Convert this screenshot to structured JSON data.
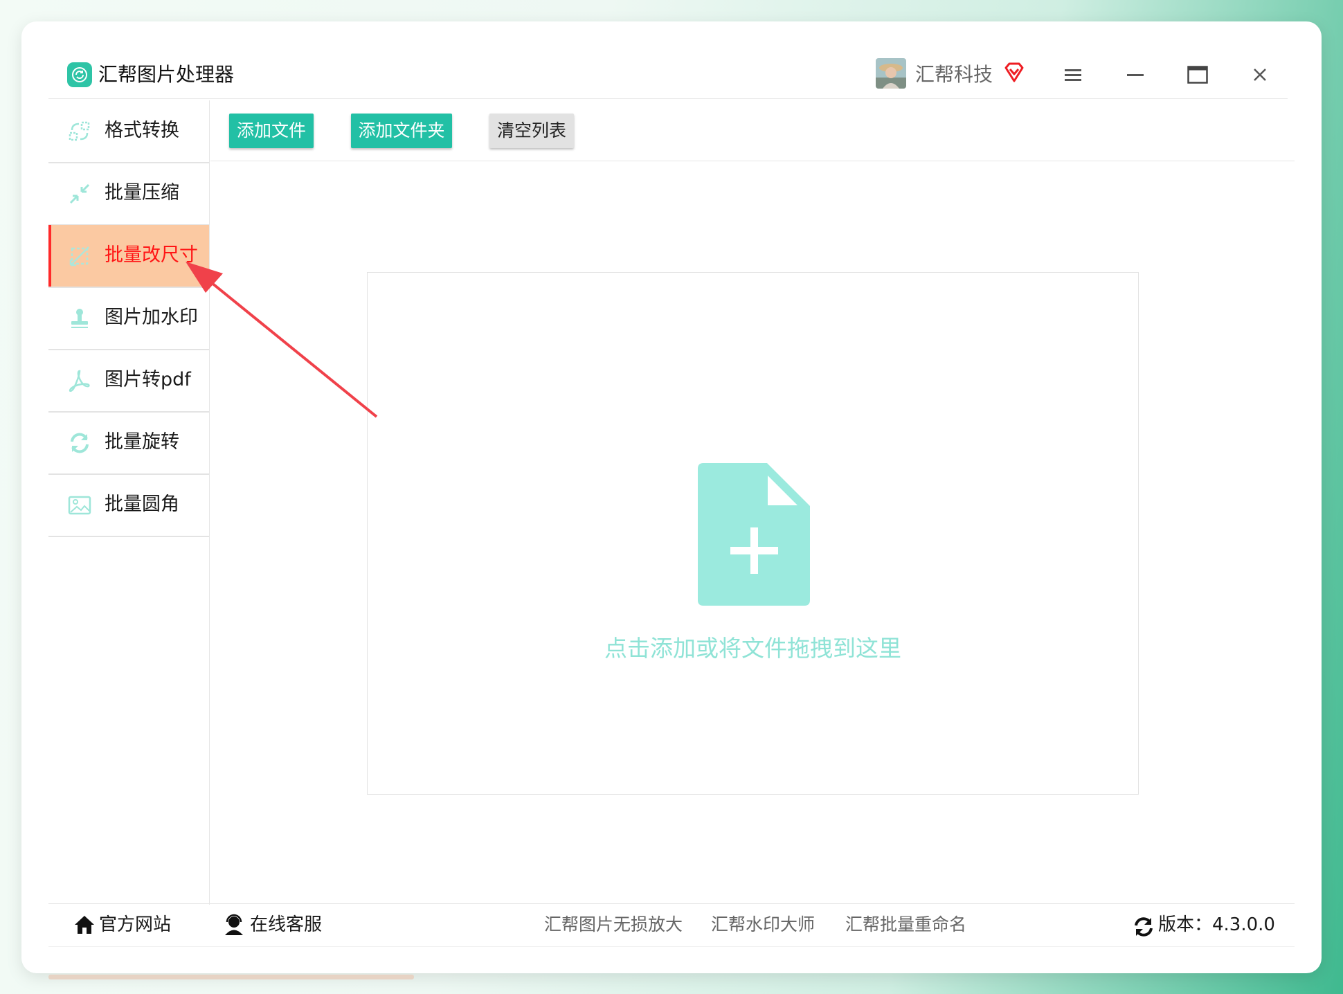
{
  "app": {
    "title": "汇帮图片处理器",
    "user_name": "汇帮科技"
  },
  "sidebar": {
    "items": [
      {
        "label": "格式转换",
        "icon": "format-convert-icon",
        "active": false
      },
      {
        "label": "批量压缩",
        "icon": "compress-icon",
        "active": false
      },
      {
        "label": "批量改尺寸",
        "icon": "resize-icon",
        "active": true
      },
      {
        "label": "图片加水印",
        "icon": "stamp-icon",
        "active": false
      },
      {
        "label": "图片转pdf",
        "icon": "pdf-icon",
        "active": false
      },
      {
        "label": "批量旋转",
        "icon": "rotate-icon",
        "active": false
      },
      {
        "label": "批量圆角",
        "icon": "image-icon",
        "active": false
      }
    ]
  },
  "toolbar": {
    "add_file": "添加文件",
    "add_folder": "添加文件夹",
    "clear_list": "清空列表"
  },
  "dropzone": {
    "hint": "点击添加或将文件拖拽到这里"
  },
  "footer": {
    "website": "官方网站",
    "support": "在线客服",
    "links": [
      "汇帮图片无损放大",
      "汇帮水印大师",
      "汇帮批量重命名"
    ],
    "version": "版本：4.3.0.0"
  },
  "colors": {
    "accent": "#22c0a5",
    "active_bg": "#fbc9a2",
    "active_text": "#ff1414",
    "annotation_arrow": "#f0414a",
    "dropzone_icon": "#9beade"
  }
}
